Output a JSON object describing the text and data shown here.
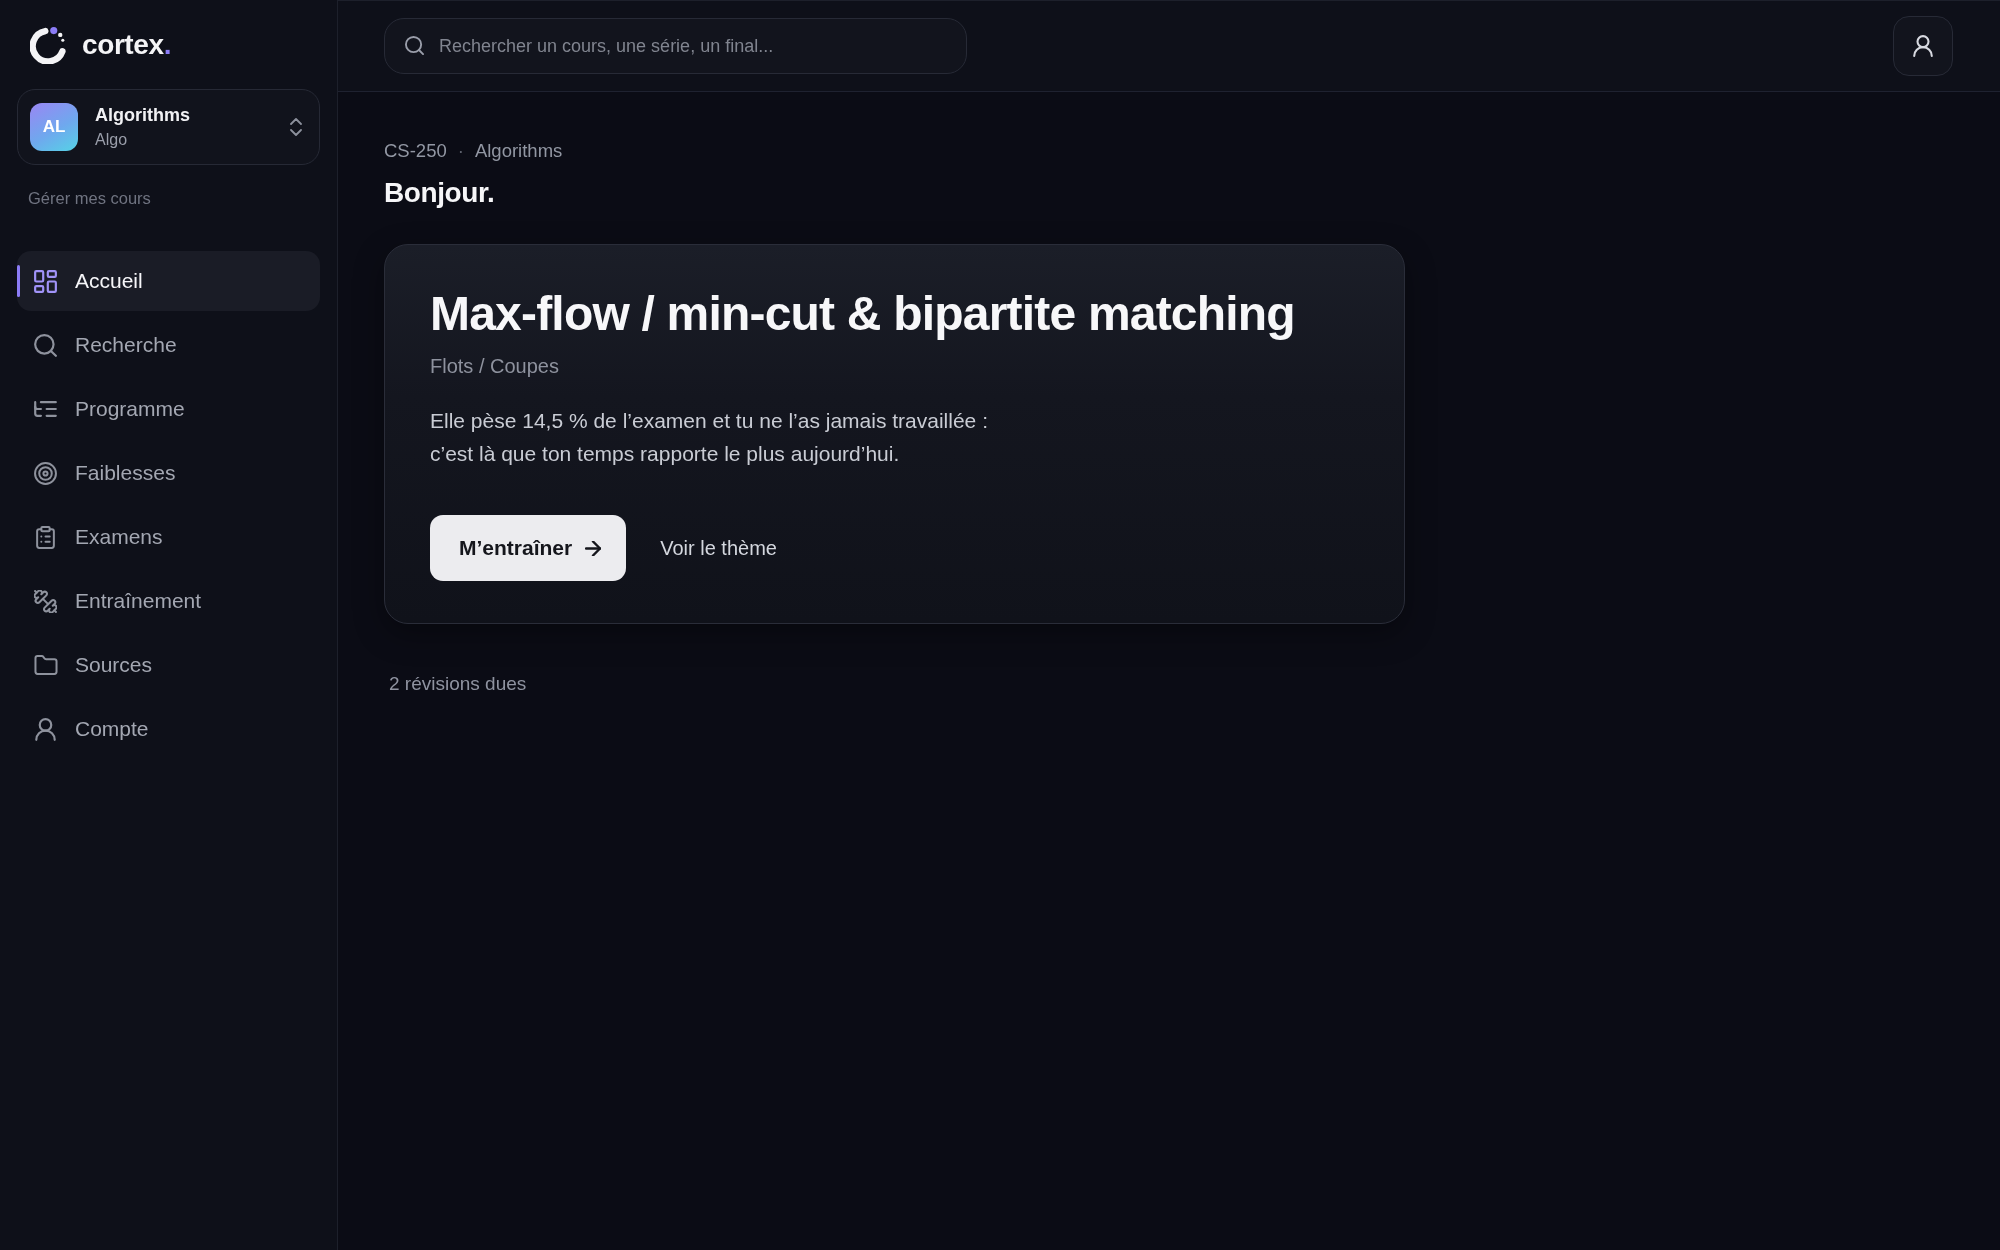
{
  "sidebar": {
    "logo": {
      "wordmark": "cortex."
    },
    "course_switcher": {
      "avatar": "AL",
      "title": "Algorithms",
      "subtitle": "Algo"
    },
    "manage_link": "Gérer mes cours",
    "nav": [
      {
        "label": "Accueil",
        "selected": true
      },
      {
        "label": "Recherche",
        "selected": false
      },
      {
        "label": "Programme",
        "selected": false
      },
      {
        "label": "Faiblesses",
        "selected": false
      },
      {
        "label": "Examens",
        "selected": false
      },
      {
        "label": "Entraînement",
        "selected": false
      },
      {
        "label": "Sources",
        "selected": false
      },
      {
        "label": "Compte",
        "selected": false
      }
    ]
  },
  "top_bar": {
    "search": {
      "placeholder": "Rechercher un cours, une série, un final..."
    }
  },
  "breadcrumb": {
    "items": [
      "CS-250",
      "Algorithms"
    ],
    "separator": "·"
  },
  "greeting": "Bonjour.",
  "focus_card": {
    "title": "Max-flow / min-cut & bipartite matching",
    "topic": "Flots / Coupes",
    "description": "Elle pèse 14,5 % de l’examen et tu ne l’as jamais travaillée : c’est là que ton temps rapporte le plus aujourd’hui.",
    "buttons": [
      {
        "label": "M’entraîner",
        "kind": "primary"
      },
      {
        "label": "Voir le thème",
        "kind": "link"
      }
    ]
  },
  "reviews_due": "2 révisions dues"
}
